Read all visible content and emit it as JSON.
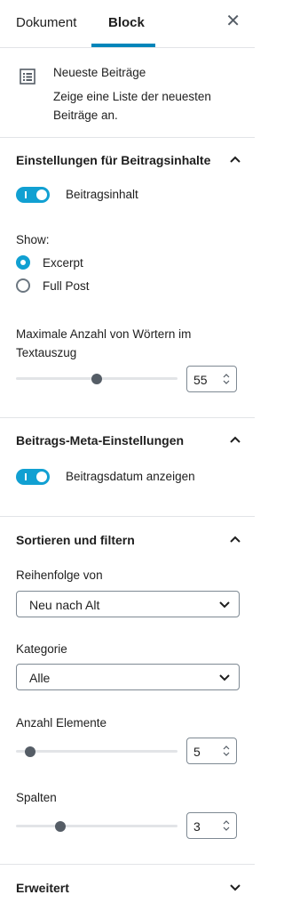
{
  "tabs": [
    {
      "label": "Dokument"
    },
    {
      "label": "Block"
    }
  ],
  "block": {
    "title": "Neueste Beiträge",
    "description": "Zeige eine Liste der neuesten Beiträge an."
  },
  "content_settings": {
    "title": "Einstellungen für Beitragsinhalte",
    "toggle_label": "Beitragsinhalt",
    "toggle_on": true,
    "show_label": "Show:",
    "radio_options": [
      {
        "label": "Excerpt",
        "selected": true
      },
      {
        "label": "Full Post",
        "selected": false
      }
    ],
    "words_label": "Maximale Anzahl von Wörtern im Textauszug",
    "words_value": "55"
  },
  "meta_settings": {
    "title": "Beitrags-Meta-Einstellungen",
    "toggle_label": "Beitragsdatum anzeigen",
    "toggle_on": true
  },
  "sort_filter": {
    "title": "Sortieren und filtern",
    "order_label": "Reihenfolge von",
    "order_value": "Neu nach Alt",
    "category_label": "Kategorie",
    "category_value": "Alle",
    "items_label": "Anzahl Elemente",
    "items_value": "5",
    "columns_label": "Spalten",
    "columns_value": "3"
  },
  "advanced": {
    "title": "Erweitert"
  },
  "colors": {
    "accent": "#11a0d2",
    "tab_underline": "#0085ba"
  }
}
